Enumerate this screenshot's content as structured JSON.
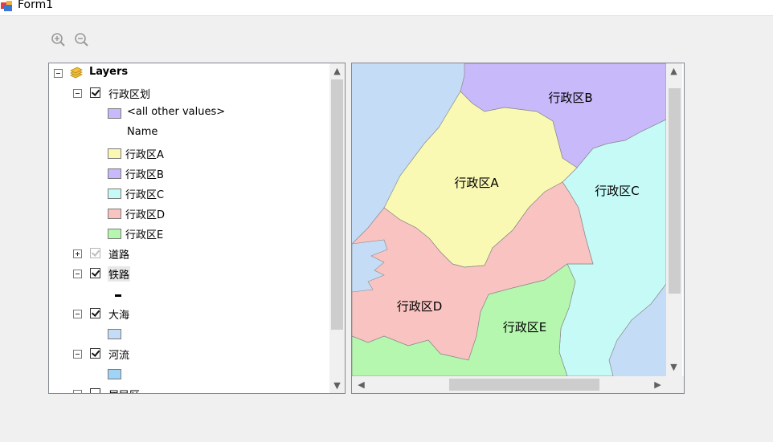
{
  "window": {
    "title": "Form1"
  },
  "toolbar": {
    "zoom_in_icon": "zoom-in-icon",
    "zoom_out_icon": "zoom-out-icon"
  },
  "toc": {
    "root_label": "Layers",
    "layers": [
      {
        "label": "行政区划",
        "checked": true,
        "expanded": true
      },
      {
        "label": "道路",
        "checked": true,
        "expanded": false,
        "disabled": true
      },
      {
        "label": "铁路",
        "checked": true,
        "expanded": true
      },
      {
        "label": "大海",
        "checked": true,
        "expanded": true
      },
      {
        "label": "河流",
        "checked": true,
        "expanded": true
      },
      {
        "label": "居民区",
        "checked": false,
        "expanded": true
      }
    ],
    "legend": {
      "all_other_values": "<all other values>",
      "field_name": "Name",
      "items": [
        {
          "label": "行政区A",
          "color": "#faf9b3"
        },
        {
          "label": "行政区B",
          "color": "#c8b9fa"
        },
        {
          "label": "行政区C",
          "color": "#c5faf6"
        },
        {
          "label": "行政区D",
          "color": "#f9c3c1"
        },
        {
          "label": "行政区E",
          "color": "#b6f7b0"
        }
      ],
      "other_color": "#c8b9fa",
      "sea_color": "#c5dcf6",
      "river_color": "#9fd4f6",
      "railway_color": "#000000"
    }
  },
  "map": {
    "labels": {
      "A": "行政区A",
      "B": "行政区B",
      "C": "行政区C",
      "D": "行政区D",
      "E": "行政区E"
    },
    "colors": {
      "A": "#faf9b3",
      "B": "#c8b9fa",
      "C": "#c5faf6",
      "D": "#f9c3c1",
      "E": "#b6f7b0",
      "sea": "#c5dcf6"
    }
  }
}
